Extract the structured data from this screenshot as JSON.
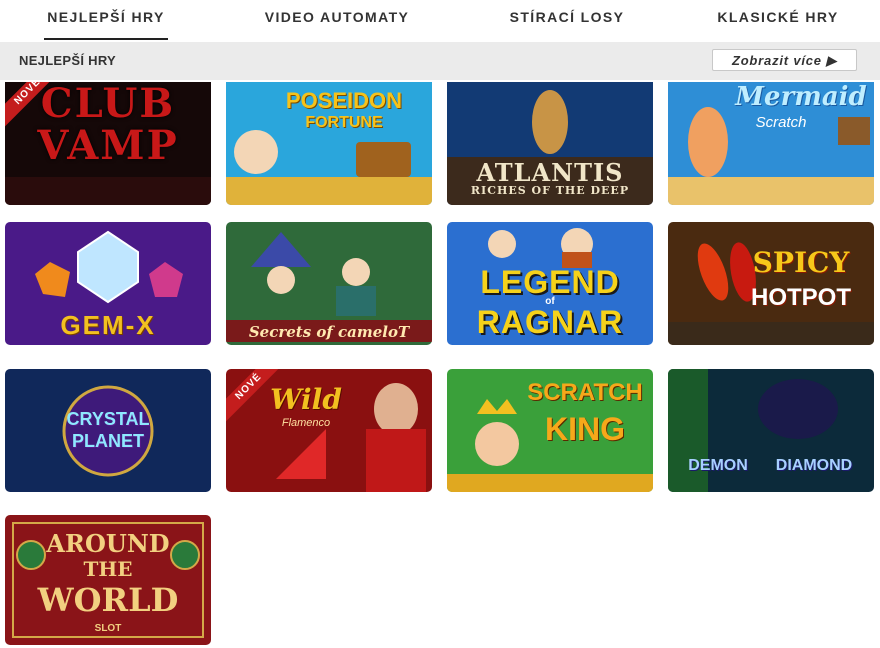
{
  "tabs": [
    {
      "label": "NEJLEPŠÍ HRY"
    },
    {
      "label": "VIDEO AUTOMATY"
    },
    {
      "label": "STÍRACÍ LOSY"
    },
    {
      "label": "KLASICKÉ HRY"
    }
  ],
  "section": {
    "title": "NEJLEPŠÍ HRY",
    "more_label": "Zobrazit více ▶"
  },
  "games": [
    {
      "lines": [
        "CLUB",
        "VAMP"
      ],
      "badge": "NOVÉ"
    },
    {
      "lines": [
        "POSEIDON",
        "FORTUNE"
      ]
    },
    {
      "lines": [
        "ATLANTIS",
        "RICHES OF THE DEEP"
      ]
    },
    {
      "lines": [
        "Mermaid",
        "Scratch"
      ]
    },
    {
      "lines": [
        "GEM-X"
      ]
    },
    {
      "lines": [
        "Secrets of cameloT"
      ]
    },
    {
      "lines": [
        "LEGEND",
        "of",
        "RAGNAR"
      ]
    },
    {
      "lines": [
        "SPICY",
        "HOTPOT"
      ]
    },
    {
      "lines": [
        "CRYSTAL",
        "PLANET"
      ]
    },
    {
      "lines": [
        "Wild",
        "Flamenco"
      ],
      "badge": "NOVÉ"
    },
    {
      "lines": [
        "SCRATCH",
        "KING"
      ]
    },
    {
      "lines": [
        "DEMON",
        "DIAMOND"
      ]
    },
    {
      "lines": [
        "AROUND",
        "THE",
        "WORLD",
        "SLOT"
      ]
    }
  ],
  "colors": {
    "accent": "#222222",
    "subbar": "#ebebeb",
    "badge": "#c41d1d"
  }
}
